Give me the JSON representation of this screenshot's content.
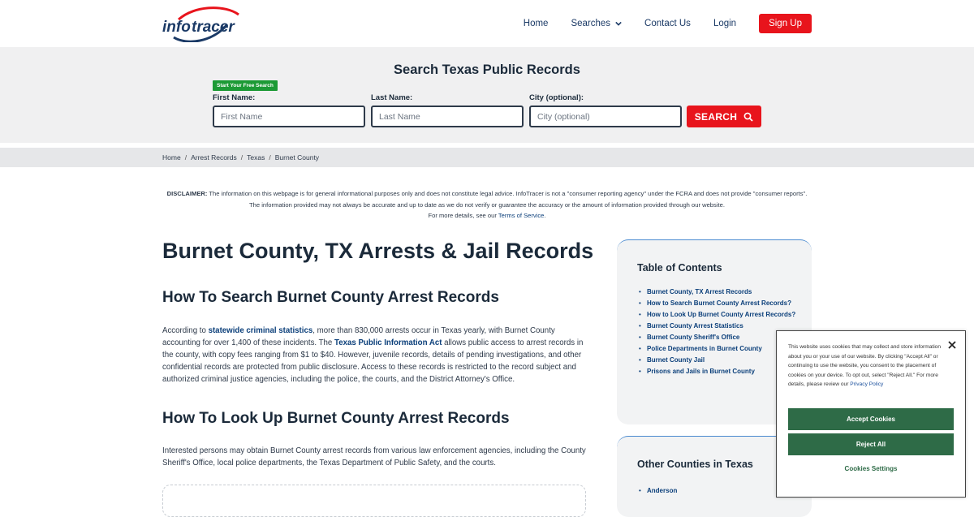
{
  "header": {
    "logo_text": "infotracer",
    "nav": {
      "home": "Home",
      "searches": "Searches",
      "contact": "Contact Us",
      "login": "Login",
      "signup": "Sign Up"
    }
  },
  "search": {
    "title": "Search Texas Public Records",
    "badge": "Start Your Free Search",
    "first_label": "First Name:",
    "first_placeholder": "First Name",
    "last_label": "Last Name:",
    "last_placeholder": "Last Name",
    "city_label": "City (optional):",
    "city_placeholder": "City (optional)",
    "button": "SEARCH"
  },
  "breadcrumb": [
    "Home",
    "Arrest Records",
    "Texas",
    "Burnet County"
  ],
  "disclaimer": {
    "lead": "DISCLAIMER:",
    "text": "The information on this webpage is for general informational purposes only and does not constitute legal advice. InfoTracer is not a \"consumer reporting agency\" under the FCRA and does not provide \"consumer reports\". The information provided may not always be accurate and up to date as we do not verify or guarantee the accuracy or the amount of information provided through our website.",
    "more": "For more details, see our",
    "link": "Terms of Service",
    "end": "."
  },
  "main": {
    "title": "Burnet County, TX Arrests & Jail Records",
    "section1_title": "How To Search Burnet County Arrest Records",
    "p1_a": "According to",
    "p1_link1": "statewide criminal statistics",
    "p1_b": ", more than 830,000 arrests occur in Texas yearly, with Burnet County accounting for over 1,400 of these incidents. The",
    "p1_link2": "Texas Public Information Act",
    "p1_c": "allows public access to arrest records in the county, with copy fees ranging from $1 to $40. However, juvenile records, details of pending investigations, and other confidential records are protected from public disclosure. Access to these records is restricted to the record subject and authorized criminal justice agencies, including the police, the courts, and the District Attorney's Office.",
    "section2_title": "How To Look Up Burnet County Arrest Records",
    "p2": "Interested persons may obtain Burnet County arrest records from various law enforcement agencies, including the County Sheriff's Office, local police departments, the Texas Department of Public Safety, and the courts."
  },
  "toc": {
    "title": "Table of Contents",
    "items": [
      "Burnet County, TX Arrest Records",
      "How to Search Burnet County Arrest Records?",
      "How to Look Up Burnet County Arrest Records?",
      "Burnet County Arrest Statistics",
      "Burnet County Sheriff's Office",
      "Police Departments in Burnet County",
      "Burnet County Jail",
      "Prisons and Jails in Burnet County"
    ]
  },
  "counties": {
    "title": "Other Counties in Texas",
    "items": [
      "Anderson"
    ]
  },
  "cookie": {
    "text": "This website uses cookies that may collect and store information about you or your use of our website. By clicking \"Accept All\" or continuing to use the website, you consent to the placement of cookies on your device. To opt out, select \"Reject All.\" For more details, please review our",
    "policy_link": "Privacy Policy",
    "accept": "Accept Cookies",
    "reject": "Reject All",
    "settings": "Cookies Settings"
  },
  "colors": {
    "accent_red": "#e8141c",
    "badge_green": "#1c9a35",
    "cookie_green": "#2e6b47",
    "link_blue": "#0b3f7a"
  }
}
